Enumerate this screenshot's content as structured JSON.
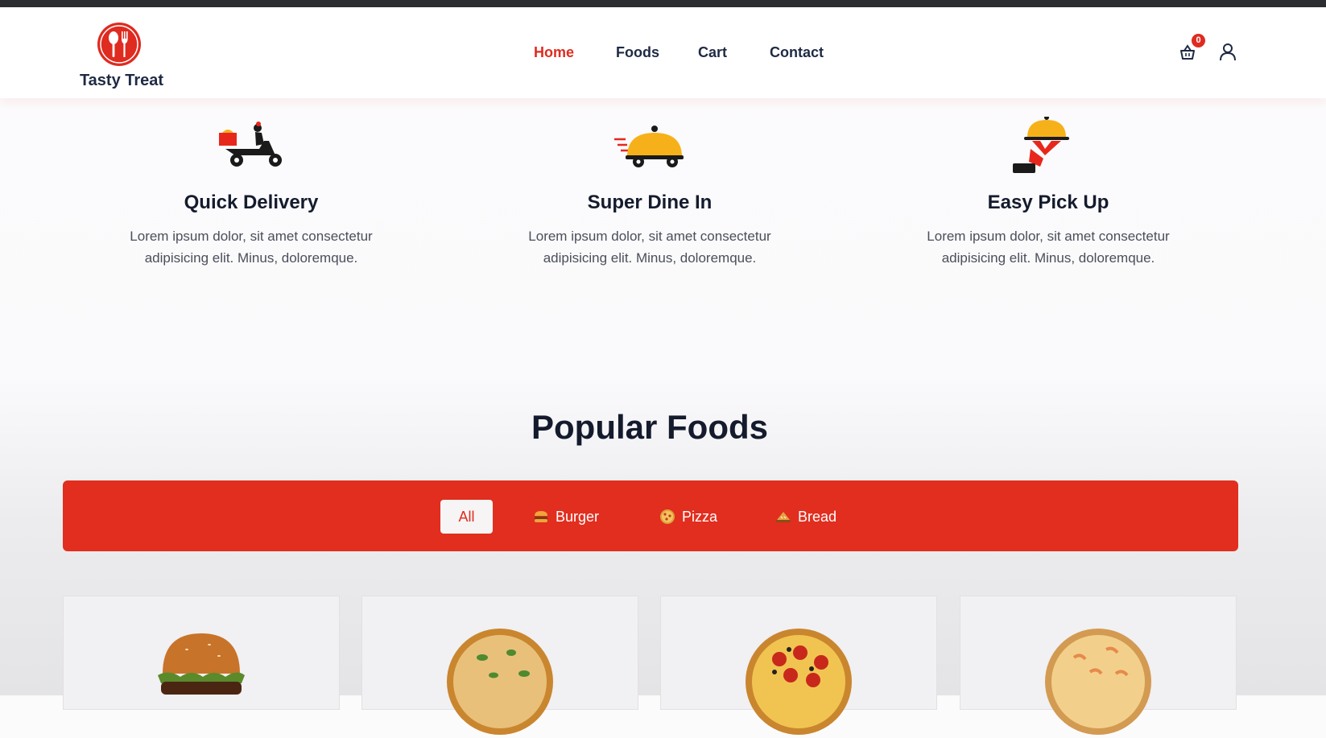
{
  "brand": {
    "name": "Tasty Treat"
  },
  "nav": [
    {
      "label": "Home",
      "active": true
    },
    {
      "label": "Foods",
      "active": false
    },
    {
      "label": "Cart",
      "active": false
    },
    {
      "label": "Contact",
      "active": false
    }
  ],
  "cart": {
    "count": "0"
  },
  "features": [
    {
      "title": "Quick Delivery",
      "text": "Lorem ipsum dolor, sit amet consectetur adipisicing elit. Minus, doloremque.",
      "icon": "delivery-scooter-icon"
    },
    {
      "title": "Super Dine In",
      "text": "Lorem ipsum dolor, sit amet consectetur adipisicing elit. Minus, doloremque.",
      "icon": "dine-in-cloche-icon"
    },
    {
      "title": "Easy Pick Up",
      "text": "Lorem ipsum dolor, sit amet consectetur adipisicing elit. Minus, doloremque.",
      "icon": "pick-up-hand-icon"
    }
  ],
  "popular": {
    "title": "Popular Foods",
    "filters": [
      {
        "label": "All",
        "active": true
      },
      {
        "label": "Burger",
        "icon": "burger-icon"
      },
      {
        "label": "Pizza",
        "icon": "pizza-icon"
      },
      {
        "label": "Bread",
        "icon": "bread-icon"
      }
    ],
    "products": [
      {
        "image": "burger"
      },
      {
        "image": "cheese-pizza"
      },
      {
        "image": "pepperoni-pizza"
      },
      {
        "image": "seafood-pizza"
      }
    ]
  },
  "colors": {
    "accent": "#df2b20",
    "heading": "#141b2d"
  }
}
